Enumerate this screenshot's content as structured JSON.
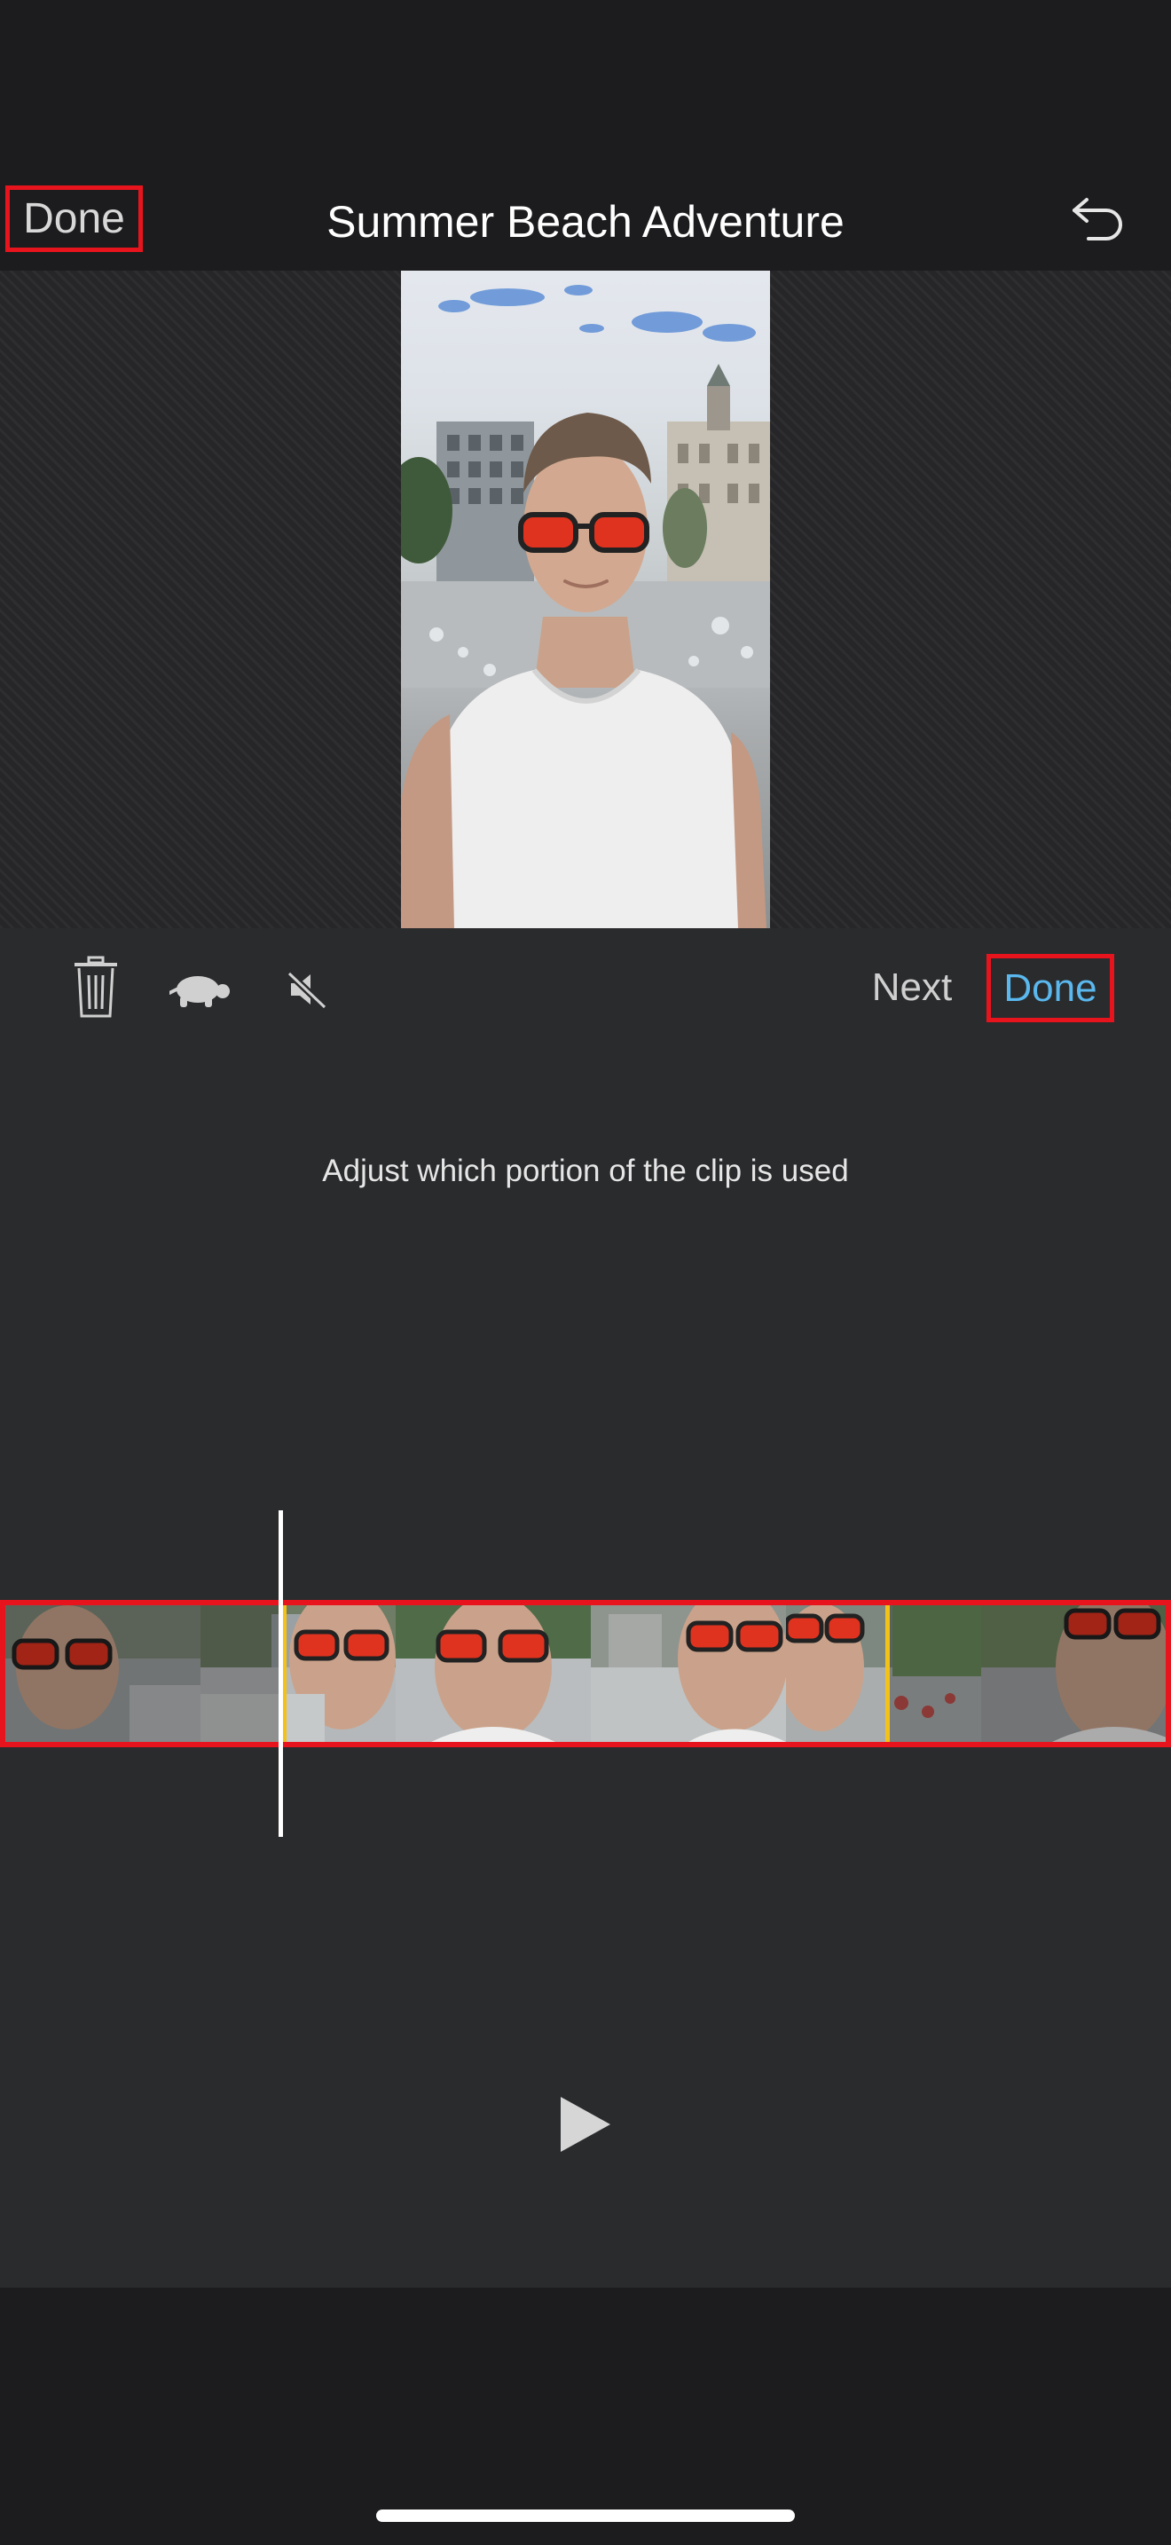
{
  "header": {
    "done_label": "Done",
    "title": "Summer Beach Adventure",
    "undo_icon": "undo-arrow-icon"
  },
  "toolbar": {
    "delete_icon": "trash-icon",
    "speed_icon": "turtle-icon",
    "mute_icon": "speaker-muted-icon",
    "next_label": "Next",
    "done_label": "Done"
  },
  "editor": {
    "hint": "Adjust which portion of the clip is used",
    "play_icon": "play-icon"
  },
  "colors": {
    "accent_blue": "#5ab8ee",
    "highlight_red": "#e8141d",
    "trim_yellow": "#f3c21a"
  }
}
